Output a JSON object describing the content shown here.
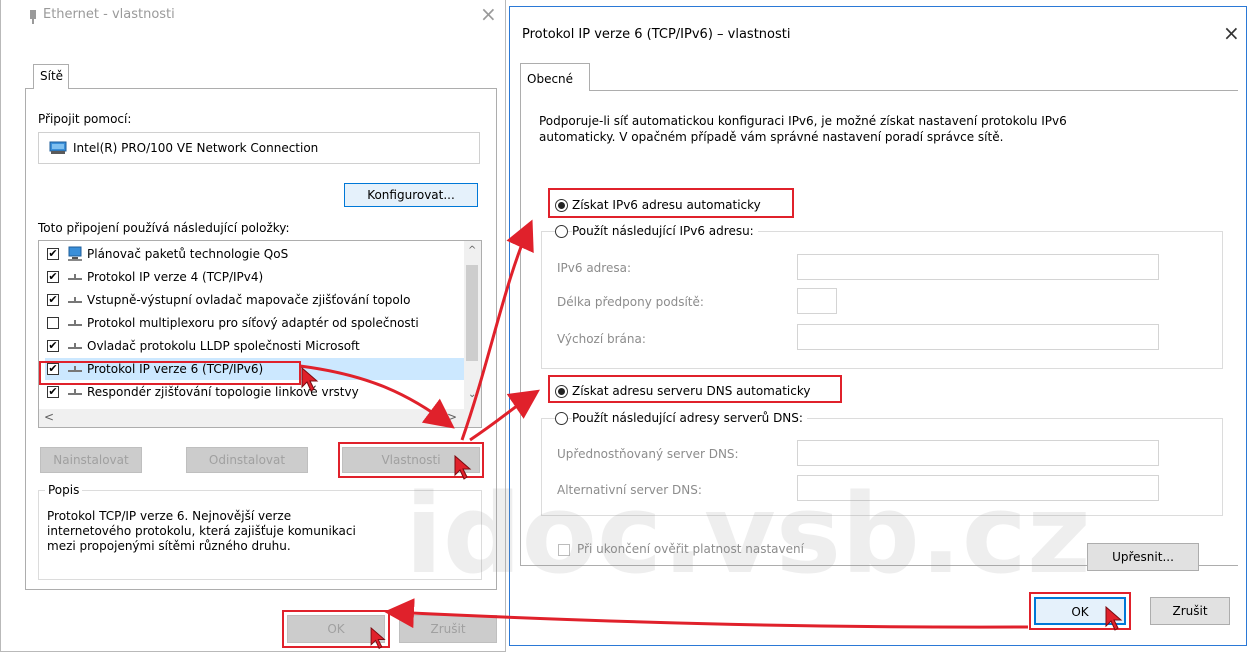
{
  "left_dialog": {
    "title": "Ethernet - vlastnosti",
    "close": "×",
    "tab": "Sítě",
    "connect_using_label": "Připojit pomocí:",
    "adapter_name": "Intel(R) PRO/100 VE Network Connection",
    "configure_button": "Konfigurovat...",
    "items_label": "Toto připojení používá následující položky:",
    "items": [
      {
        "label": "Plánovač paketů technologie QoS",
        "checked": true
      },
      {
        "label": "Protokol IP verze 4 (TCP/IPv4)",
        "checked": true
      },
      {
        "label": "Vstupně-výstupní ovladač mapovače zjišťování topolo",
        "checked": true
      },
      {
        "label": "Protokol multiplexoru pro síťový adaptér od společnosti",
        "checked": false
      },
      {
        "label": "Ovladač protokolu LLDP společnosti Microsoft",
        "checked": true
      },
      {
        "label": "Protokol IP verze 6 (TCP/IPv6)",
        "checked": true
      },
      {
        "label": "Respondér zjišťování topologie linkové vrstvy",
        "checked": true
      }
    ],
    "install_button": "Nainstalovat",
    "uninstall_button": "Odinstalovat",
    "properties_button": "Vlastnosti",
    "description_label": "Popis",
    "description_text": "Protokol TCP/IP verze 6. Nejnovější verze internetového protokolu, která zajišťuje komunikaci mezi propojenými sítěmi různého druhu.",
    "ok_button": "OK",
    "cancel_button": "Zrušit"
  },
  "right_dialog": {
    "title": "Protokol IP verze 6 (TCP/IPv6) – vlastnosti",
    "close": "×",
    "tab": "Obecné",
    "intro_text_line1": "Podporuje-li síť automatickou konfiguraci IPv6, je možné získat nastavení protokolu IPv6",
    "intro_text_line2": "automaticky. V opačném případě vám správné nastavení poradí správce sítě.",
    "radio_auto_ip": "Získat IPv6 adresu automaticky",
    "radio_manual_ip": "Použít následující IPv6 adresu:",
    "ipv6_address_label": "IPv6 adresa:",
    "prefix_length_label": "Délka předpony podsítě:",
    "default_gateway_label": "Výchozí brána:",
    "radio_auto_dns": "Získat adresu serveru DNS automaticky",
    "radio_manual_dns": "Použít následující adresy serverů DNS:",
    "preferred_dns_label": "Upřednostňovaný server DNS:",
    "alternate_dns_label": "Alternativní server DNS:",
    "validate_checkbox": "Při ukončení ověřit platnost nastavení",
    "advanced_button": "Upřesnit...",
    "ok_button": "OK",
    "cancel_button": "Zrušit"
  },
  "watermark": {
    "big": "idoc",
    "url": "idoc.vsb.cz"
  },
  "colors": {
    "highlight_red": "#e0212b",
    "selection_blue": "#cce8ff"
  }
}
